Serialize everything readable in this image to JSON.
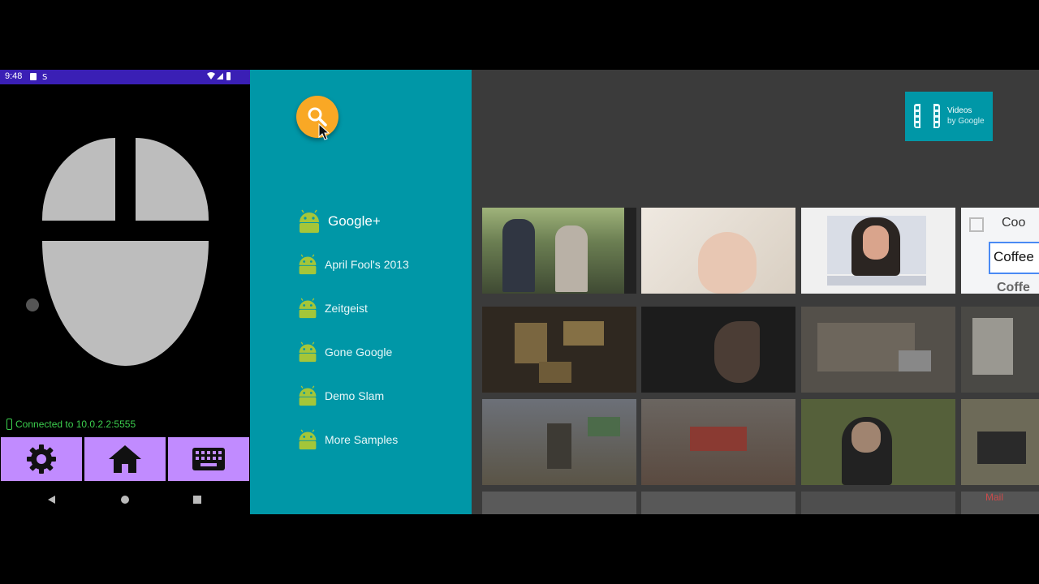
{
  "phone": {
    "status_time": "9:48",
    "connection_text": "Connected to 10.0.2.2:5555",
    "buttons": {
      "settings_icon": "gear-icon",
      "home_icon": "home-icon",
      "keyboard_icon": "keyboard-icon"
    },
    "colors": {
      "status_bar": "#3a1fb5",
      "button": "#c18bff",
      "connected": "#3ccf4e"
    }
  },
  "tv": {
    "categories": [
      {
        "label": "Google+"
      },
      {
        "label": "April Fool's 2013"
      },
      {
        "label": "Zeitgeist"
      },
      {
        "label": "Gone Google"
      },
      {
        "label": "Demo Slam"
      },
      {
        "label": "More Samples"
      }
    ],
    "brand": {
      "title": "Videos",
      "subtitle": "by Google"
    },
    "tile_texts": {
      "coffee_top": "Coo",
      "coffee_box": "Coffee",
      "coffee_bottom": "Coffe",
      "mail": "Mail"
    },
    "colors": {
      "sidebar": "#0097a7",
      "search_orb": "#f9a825",
      "main_bg": "#3b3b3b"
    }
  }
}
